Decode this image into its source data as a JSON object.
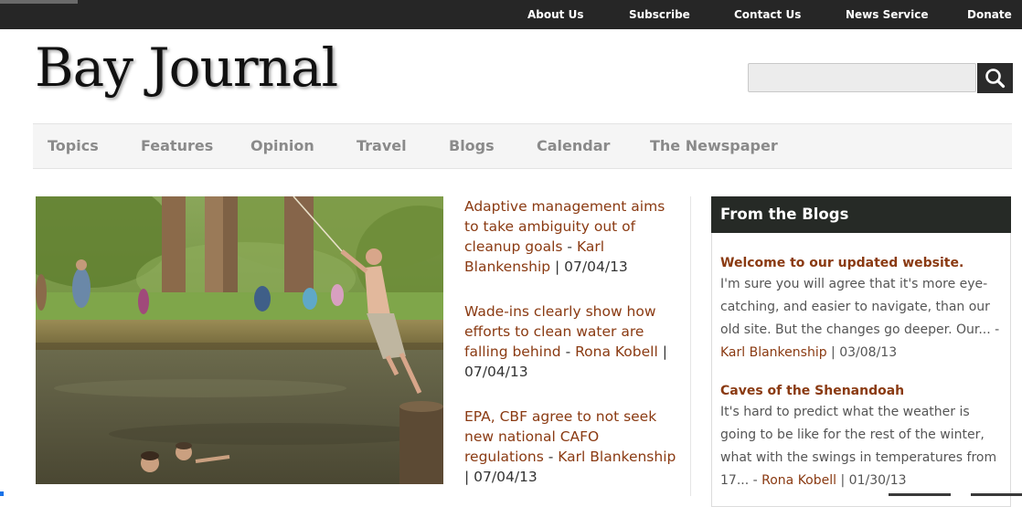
{
  "topnav": {
    "items": [
      "About Us",
      "Subscribe",
      "Contact Us",
      "News Service",
      "Donate"
    ]
  },
  "header": {
    "logo": "Bay Journal",
    "search": {
      "value": "",
      "placeholder": ""
    }
  },
  "mainnav": {
    "items": [
      "Topics",
      "Features",
      "Opinion",
      "Travel",
      "Blogs",
      "Calendar",
      "The Newspaper"
    ]
  },
  "headlines": [
    {
      "title": "Adaptive management aims to take ambiguity out of cleanup goals",
      "author": "Karl Blankenship",
      "date": "07/04/13"
    },
    {
      "title": "Wade-ins clearly show how efforts to clean water are falling behind",
      "author": "Rona Kobell",
      "date": "07/04/13"
    },
    {
      "title": "EPA, CBF agree to not seek new national CAFO regulations",
      "author": "Karl Blankenship",
      "date": "07/04/13"
    }
  ],
  "blogs": {
    "heading": "From the Blogs",
    "posts": [
      {
        "title": "Welcome to our updated website.",
        "excerpt": "I'm sure you will agree that it's more eye-catching, and easier to navigate, than our old site. But the changes go deeper. Our...",
        "author": "Karl Blankenship",
        "date": "03/08/13"
      },
      {
        "title": "Caves of the Shenandoah",
        "excerpt": "It's hard to predict what the weather is going to be like for the rest of the winter, what with the swings in temperatures from 17...",
        "author": "Rona Kobell",
        "date": "01/30/13"
      }
    ]
  },
  "colors": {
    "topbar": "#262626",
    "accent_link": "#8a3a12",
    "nav_text": "#8a8a8a",
    "blogs_header": "#262a26"
  },
  "icons": {
    "search": "magnifier-icon"
  }
}
